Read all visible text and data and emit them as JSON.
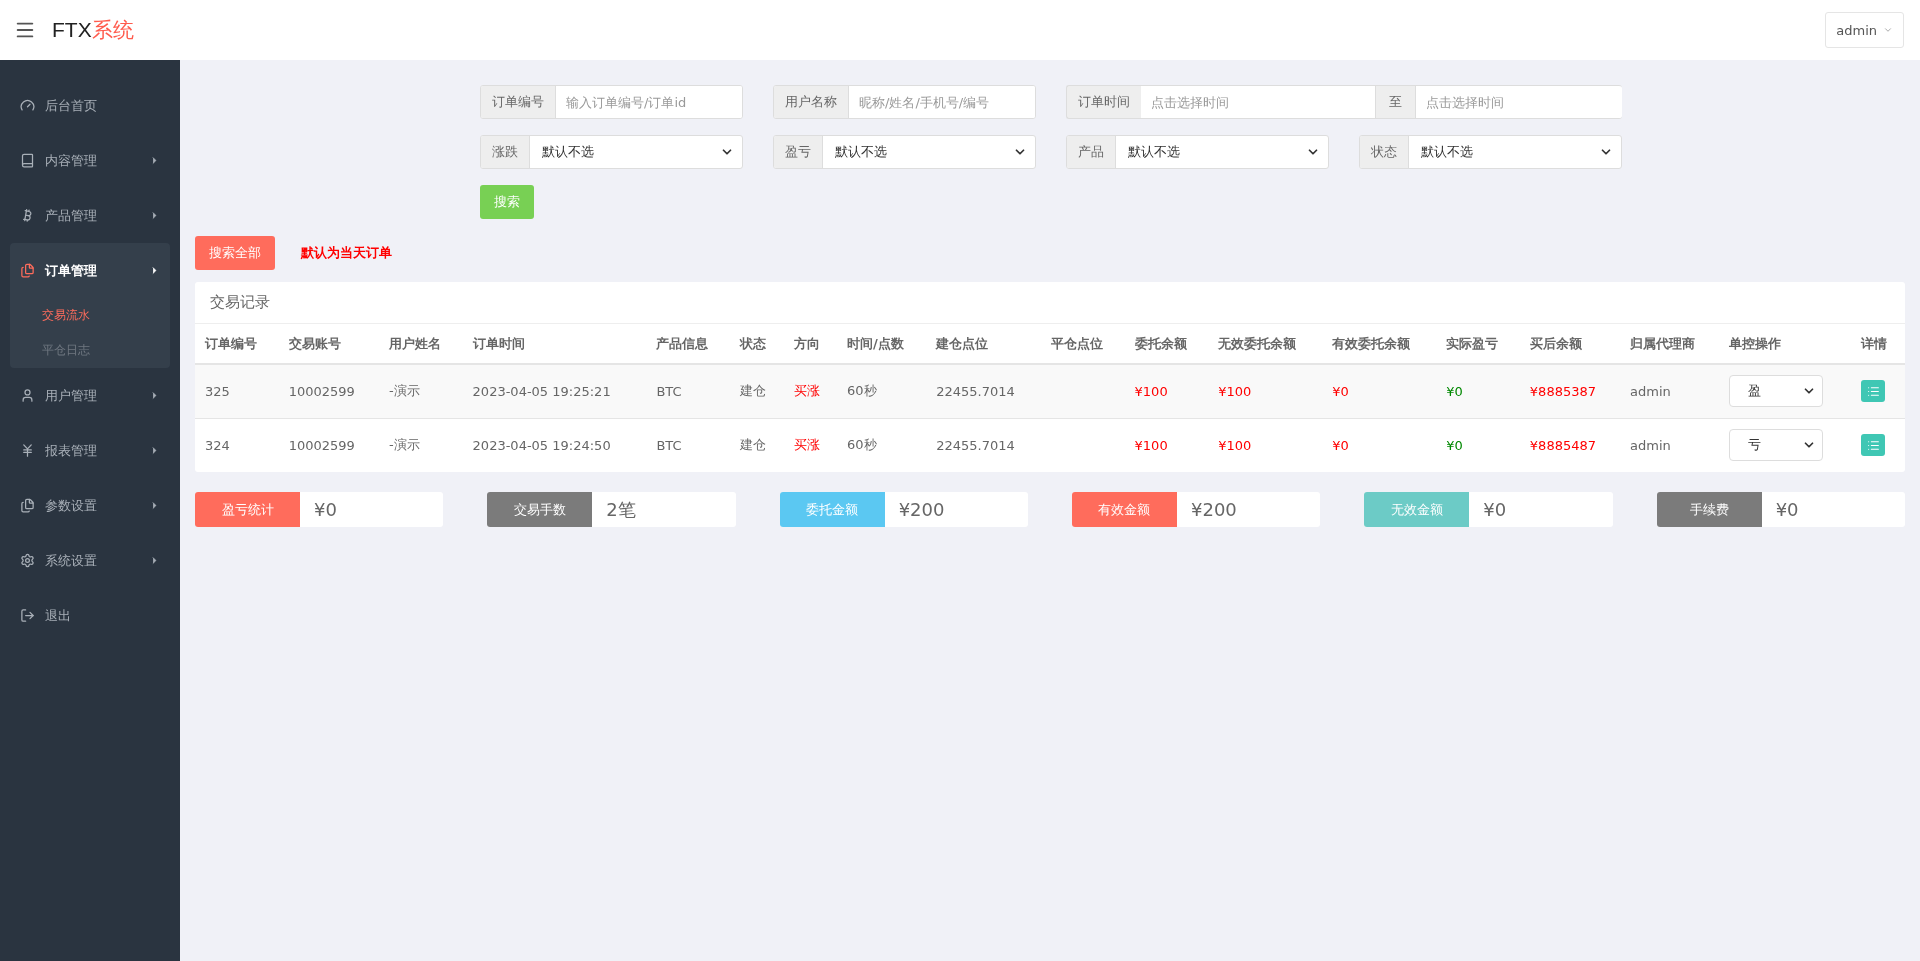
{
  "header": {
    "brand": "FTX",
    "brand_suffix": "系统",
    "user": "admin"
  },
  "sidebar": {
    "items": [
      {
        "label": "后台首页",
        "has_children": false,
        "expanded": false
      },
      {
        "label": "内容管理",
        "has_children": true,
        "expanded": false
      },
      {
        "label": "产品管理",
        "has_children": true,
        "expanded": false
      },
      {
        "label": "订单管理",
        "has_children": true,
        "expanded": true,
        "children": [
          {
            "label": "交易流水",
            "selected": true
          },
          {
            "label": "平仓日志",
            "selected": false
          }
        ]
      },
      {
        "label": "用户管理",
        "has_children": true,
        "expanded": false
      },
      {
        "label": "报表管理",
        "has_children": true,
        "expanded": false
      },
      {
        "label": "参数设置",
        "has_children": true,
        "expanded": false
      },
      {
        "label": "系统设置",
        "has_children": true,
        "expanded": false
      },
      {
        "label": "退出",
        "has_children": false,
        "expanded": false
      }
    ]
  },
  "filters": {
    "inputs": [
      {
        "label": "订单编号",
        "placeholder": "输入订单编号/订单id"
      },
      {
        "label": "用户名称",
        "placeholder": "昵称/姓名/手机号/编号"
      }
    ],
    "time": {
      "label": "订单时间",
      "from_placeholder": "点击选择时间",
      "separator": "至",
      "to_placeholder": "点击选择时间"
    },
    "selects": [
      {
        "label": "涨跌",
        "value": "默认不选"
      },
      {
        "label": "盈亏",
        "value": "默认不选"
      },
      {
        "label": "产品",
        "value": "默认不选"
      },
      {
        "label": "状态",
        "value": "默认不选"
      }
    ],
    "search_button": "搜索"
  },
  "search_all_button": "搜索全部",
  "note": "默认为当天订单",
  "table": {
    "title": "交易记录",
    "columns": [
      {
        "label": "订单编号",
        "kind": "plain"
      },
      {
        "label": "交易账号",
        "kind": "plain"
      },
      {
        "label": "用户姓名",
        "kind": "plain"
      },
      {
        "label": "订单时间",
        "kind": "plain"
      },
      {
        "label": "产品信息",
        "kind": "plain"
      },
      {
        "label": "状态",
        "kind": "plain"
      },
      {
        "label": "方向",
        "kind": "red"
      },
      {
        "label": "时间/点数",
        "kind": "plain"
      },
      {
        "label": "建仓点位",
        "kind": "plain"
      },
      {
        "label": "平仓点位",
        "kind": "plain"
      },
      {
        "label": "委托余额",
        "kind": "red"
      },
      {
        "label": "无效委托余额",
        "kind": "red"
      },
      {
        "label": "有效委托余额",
        "kind": "red"
      },
      {
        "label": "实际盈亏",
        "kind": "green"
      },
      {
        "label": "买后余额",
        "kind": "red"
      },
      {
        "label": "归属代理商",
        "kind": "plain"
      },
      {
        "label": "单控操作",
        "kind": "select"
      },
      {
        "label": "详情",
        "kind": "button"
      }
    ],
    "rows": [
      {
        "cells": [
          "325",
          "10002599",
          "-演示",
          "2023-04-05 19:25:21",
          "BTC",
          "建仓",
          "买涨",
          "60秒",
          "22455.7014",
          "",
          "¥100",
          "¥100",
          "¥0",
          "¥0",
          "¥8885387",
          "admin",
          "盈",
          ""
        ]
      },
      {
        "cells": [
          "324",
          "10002599",
          "-演示",
          "2023-04-05 19:24:50",
          "BTC",
          "建仓",
          "买涨",
          "60秒",
          "22455.7014",
          "",
          "¥100",
          "¥100",
          "¥0",
          "¥0",
          "¥8885487",
          "admin",
          "亏",
          ""
        ]
      }
    ]
  },
  "stats": [
    {
      "label": "盈亏统计",
      "value": "¥0",
      "color": "#ff6c5c"
    },
    {
      "label": "交易手数",
      "value": "2笔",
      "color": "#7b7b7b"
    },
    {
      "label": "委托金额",
      "value": "¥200",
      "color": "#5bc8f2"
    },
    {
      "label": "有效金额",
      "value": "¥200",
      "color": "#ff6c5c"
    },
    {
      "label": "无效金额",
      "value": "¥0",
      "color": "#6ccbc6"
    },
    {
      "label": "手续费",
      "value": "¥0",
      "color": "#7b7b7b"
    }
  ]
}
